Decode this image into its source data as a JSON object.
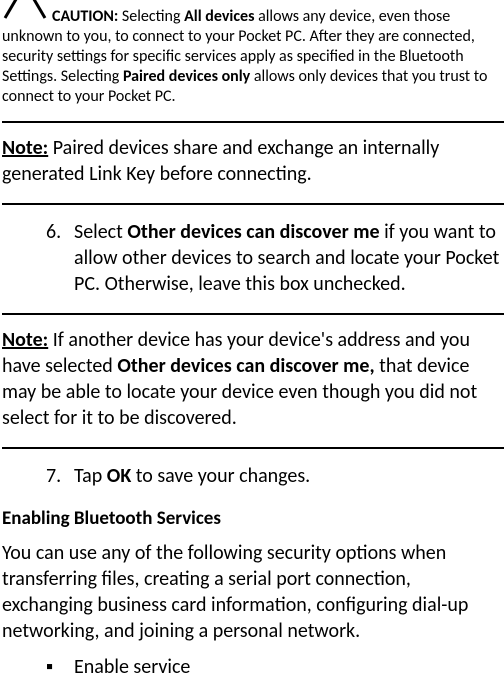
{
  "caution": {
    "label": "CAUTION:",
    "text_before_bold1": " Selecting ",
    "bold1": "All devices",
    "text_mid": " allows any device, even those unknown to you, to connect to your Pocket PC. After they are connected, security settings for specific services apply as specified in the Bluetooth Settings. Selecting ",
    "bold2": "Paired devices only",
    "text_after": " allows only devices that you trust to connect to your Pocket PC."
  },
  "note1": {
    "label": "Note:",
    "text": " Paired devices share and exchange an internally generated Link Key before connecting."
  },
  "step6": {
    "num": "6.",
    "text_before_bold": "Select ",
    "bold": "Other devices can discover me",
    "text_after": " if you want to allow other devices to search and locate your Pocket PC. Otherwise, leave this box unchecked."
  },
  "note2": {
    "label": "Note:",
    "text_before_bold": " If another device has your device's address and you have selected ",
    "bold": "Other devices can discover me,",
    "text_after": " that device may be able to locate your device even though you did not select for it to be discovered."
  },
  "step7": {
    "num": "7.",
    "text_before_bold": "Tap ",
    "bold": "OK",
    "text_after": " to save your changes."
  },
  "section_heading": "Enabling Bluetooth Services",
  "body_para": "You can use any of the following security options when transferring files, creating a serial port connection, exchanging business card information, configuring dial-up networking, and joining a personal network.",
  "bullet1": {
    "symbol": "▪",
    "text": "Enable service"
  }
}
